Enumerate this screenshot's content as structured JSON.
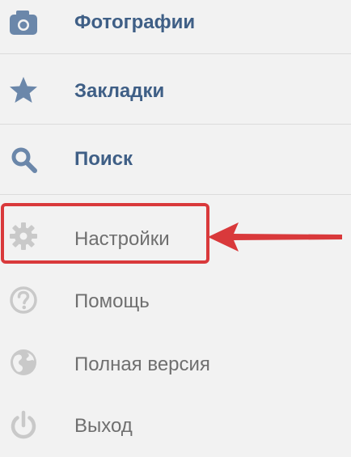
{
  "menu": {
    "items": [
      {
        "id": "photos",
        "label": "Фотографии",
        "icon": "camera-icon",
        "style": "primary"
      },
      {
        "id": "bookmarks",
        "label": "Закладки",
        "icon": "star-icon",
        "style": "primary"
      },
      {
        "id": "search",
        "label": "Поиск",
        "icon": "search-icon",
        "style": "primary"
      },
      {
        "id": "settings",
        "label": "Настройки",
        "icon": "gear-icon",
        "style": "secondary"
      },
      {
        "id": "help",
        "label": "Помощь",
        "icon": "help-icon",
        "style": "secondary"
      },
      {
        "id": "full_version",
        "label": "Полная версия",
        "icon": "globe-icon",
        "style": "secondary"
      },
      {
        "id": "logout",
        "label": "Выход",
        "icon": "power-icon",
        "style": "secondary"
      }
    ]
  },
  "annotation": {
    "highlighted_item": "settings",
    "color": "#d9393b"
  },
  "colors": {
    "background": "#f2f2f2",
    "primary_text": "#3f5f86",
    "secondary_text": "#6f6f6f",
    "icon_primary": "#6b87aa",
    "icon_secondary": "#c9c9c9",
    "divider": "#dcdcdc"
  }
}
